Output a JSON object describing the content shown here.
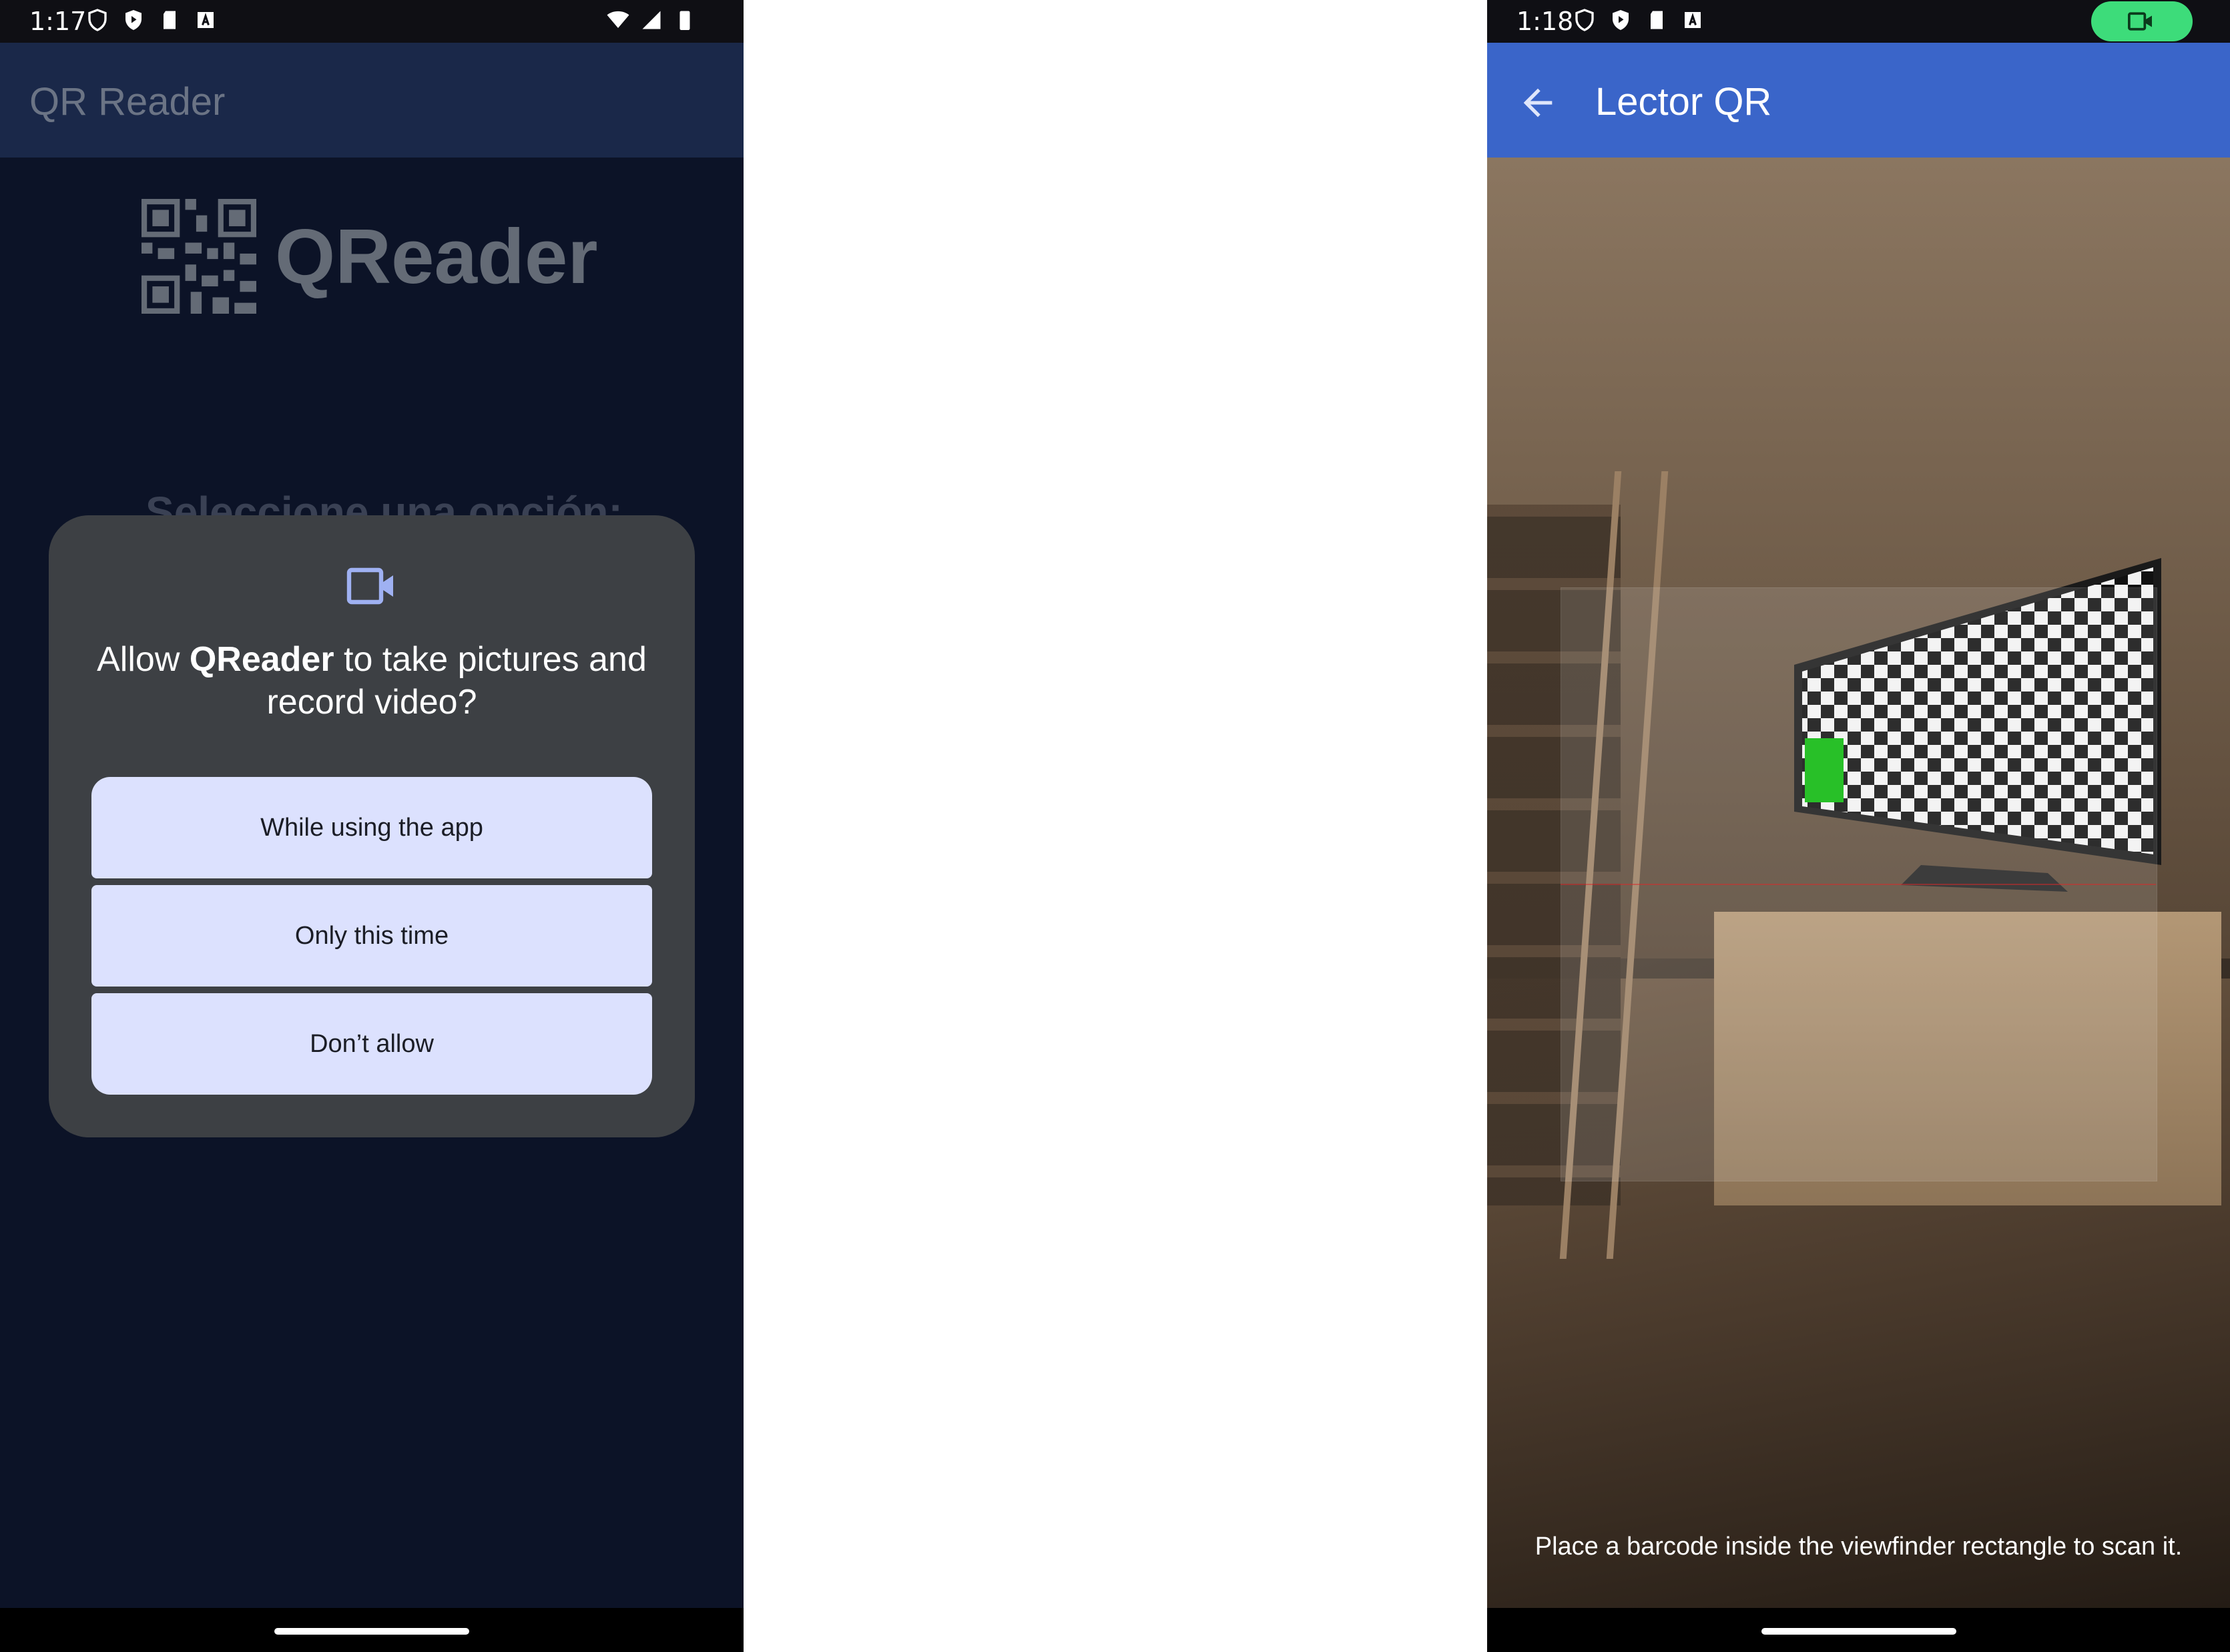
{
  "left": {
    "status": {
      "time": "1:17"
    },
    "appbar": {
      "title": "QR Reader"
    },
    "logo": {
      "text": "QReader"
    },
    "background_subtitle": "Seleccione una opción:",
    "dialog": {
      "message_prefix": "Allow ",
      "app_name": "QReader",
      "message_suffix": " to take pictures and record video?",
      "buttons": [
        {
          "label": "While using the app"
        },
        {
          "label": "Only this time"
        },
        {
          "label": "Don’t allow"
        }
      ]
    }
  },
  "right": {
    "status": {
      "time": "1:18"
    },
    "appbar": {
      "title": "Lector QR"
    },
    "scan_hint": "Place a barcode inside the viewfinder rectangle to scan it.",
    "colors": {
      "appbar": "#3a65c9",
      "recording_pill": "#3ddc7a"
    }
  },
  "icons": [
    "shield-icon",
    "play-protect-icon",
    "sd-card-icon",
    "a-icon",
    "wifi-icon",
    "signal-icon",
    "battery-icon",
    "video-camera-icon",
    "back-arrow-icon",
    "qr-code-icon"
  ]
}
